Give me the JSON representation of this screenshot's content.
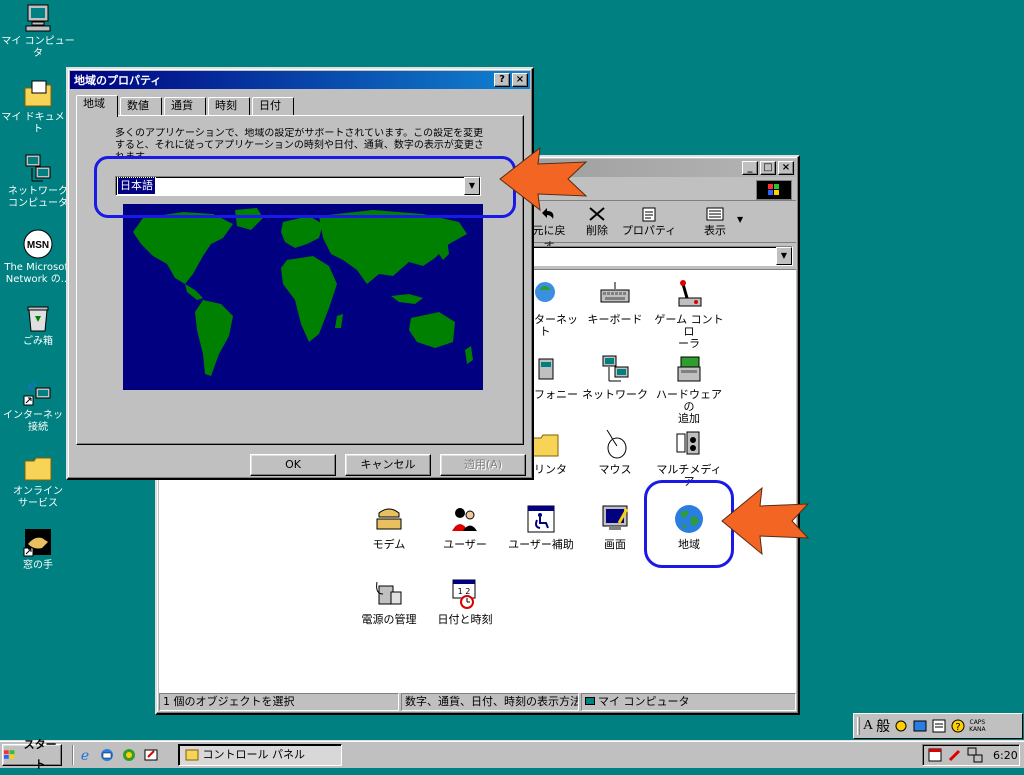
{
  "desktop": {
    "icons": [
      {
        "label": "マイ コンピュータ",
        "icon": "my-computer-icon"
      },
      {
        "label": "マイ ドキュメント",
        "icon": "my-documents-icon"
      },
      {
        "label": "ネットワーク\nコンピュータ",
        "icon": "network-computer-icon"
      },
      {
        "label": "The Microsoft\nNetwork の...",
        "icon": "msn-icon"
      },
      {
        "label": "ごみ箱",
        "icon": "recycle-bin-icon"
      },
      {
        "label": "インターネット\n接続",
        "icon": "internet-connection-icon"
      },
      {
        "label": "オンライン\nサービス",
        "icon": "online-services-folder-icon"
      },
      {
        "label": "窓の手",
        "icon": "madonote-icon"
      }
    ]
  },
  "control_panel": {
    "toolbar": {
      "undo_label": "元に戻す",
      "delete_label": "削除",
      "properties_label": "プロパティ",
      "view_label": "表示"
    },
    "items": [
      {
        "label": "インターネット",
        "icon": "internet-options-icon"
      },
      {
        "label": "キーボード",
        "icon": "keyboard-icon"
      },
      {
        "label": "ゲーム コントロ\nーラ",
        "icon": "game-controller-icon"
      },
      {
        "label": "テレフォニー",
        "icon": "telephony-icon"
      },
      {
        "label": "ネットワーク",
        "icon": "network-icon"
      },
      {
        "label": "ハードウェアの\n追加",
        "icon": "add-hardware-icon"
      },
      {
        "label": "プリンタ",
        "icon": "printers-icon"
      },
      {
        "label": "マウス",
        "icon": "mouse-icon"
      },
      {
        "label": "マルチメディア",
        "icon": "multimedia-icon"
      },
      {
        "label": "モデム",
        "icon": "modem-icon"
      },
      {
        "label": "ユーザー",
        "icon": "users-icon"
      },
      {
        "label": "ユーザー補助",
        "icon": "accessibility-icon"
      },
      {
        "label": "画面",
        "icon": "display-icon"
      },
      {
        "label": "地域",
        "icon": "regional-settings-icon"
      },
      {
        "label": "電源の管理",
        "icon": "power-management-icon"
      },
      {
        "label": "日付と時刻",
        "icon": "date-time-icon"
      }
    ],
    "status": {
      "selection": "1 個のオブジェクトを選択",
      "description": "数字、通貨、日付、時刻の表示方法",
      "location": "マイ コンピュータ"
    }
  },
  "dialog": {
    "title": "地域のプロパティ",
    "help_btn": "?",
    "close_btn": "×",
    "tabs": [
      "地域",
      "数値",
      "通貨",
      "時刻",
      "日付"
    ],
    "description": "多くのアプリケーションで、地域の設定がサポートされています。この設定を変更すると、それに従ってアプリケーションの時刻や日付、通貨、数字の表示が変更されます。",
    "locale_value": "日本語",
    "ok_label": "OK",
    "cancel_label": "キャンセル",
    "apply_label": "適用(A)"
  },
  "taskbar": {
    "start_label": "スタート",
    "task_label": "コントロール パネル",
    "clock": "6:20",
    "ime_labels": [
      "A",
      "般"
    ],
    "caps_label": "CAPS",
    "kana_label": "KANA"
  },
  "colors": {
    "desktop": "#008080",
    "titlebar_active": "#000080",
    "map_ocean": "#000080",
    "map_land": "#008000",
    "callout_arrow": "#f26522",
    "highlight_ring": "#1a1ae6"
  }
}
